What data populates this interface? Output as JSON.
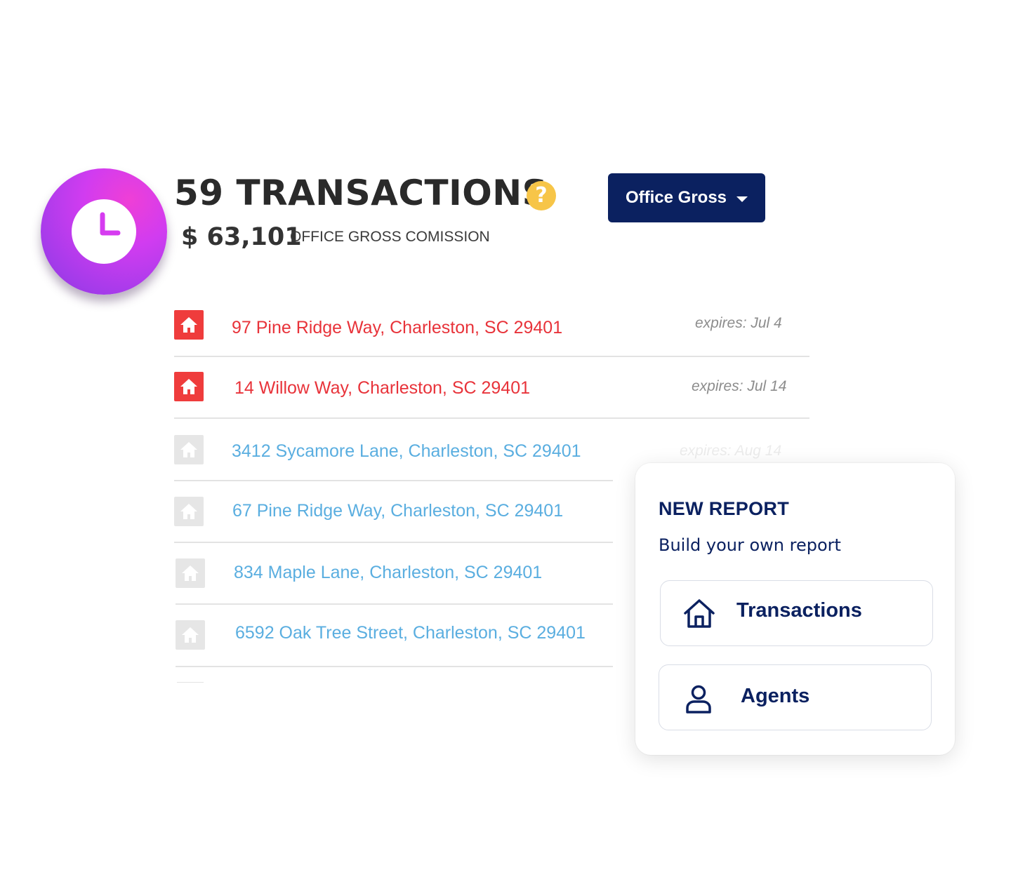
{
  "header": {
    "title": "59 TRANSACTIONS",
    "help_symbol": "?",
    "gross_amount": "$ 63,101",
    "gross_label": "OFFICE GROSS COMISSION",
    "dropdown_label": "Office Gross"
  },
  "transactions": [
    {
      "address": "97 Pine Ridge Way, Charleston, SC 29401",
      "expires": "expires: Jul 4",
      "status": "urgent"
    },
    {
      "address": "14 Willow Way, Charleston, SC 29401",
      "expires": "expires: Jul 14",
      "status": "urgent"
    },
    {
      "address": "3412 Sycamore Lane, Charleston, SC 29401",
      "expires": "expires: Aug 14",
      "status": "normal"
    },
    {
      "address": "67 Pine Ridge Way, Charleston, SC 29401",
      "expires": "",
      "status": "normal"
    },
    {
      "address": "834 Maple Lane, Charleston, SC 29401",
      "expires": "",
      "status": "normal"
    },
    {
      "address": "6592 Oak Tree Street, Charleston, SC 29401",
      "expires": "",
      "status": "normal"
    }
  ],
  "report_card": {
    "title": "NEW REPORT",
    "subtitle": "Build your own report",
    "options": [
      {
        "label": "Transactions",
        "icon": "house-outline-icon"
      },
      {
        "label": "Agents",
        "icon": "user-outline-icon"
      }
    ]
  },
  "colors": {
    "navy": "#0b2160",
    "urgent_red": "#ef3c3c",
    "link_blue": "#5aaee0",
    "help_yellow": "#f7c548",
    "badge_purple": "#c93cf0"
  }
}
